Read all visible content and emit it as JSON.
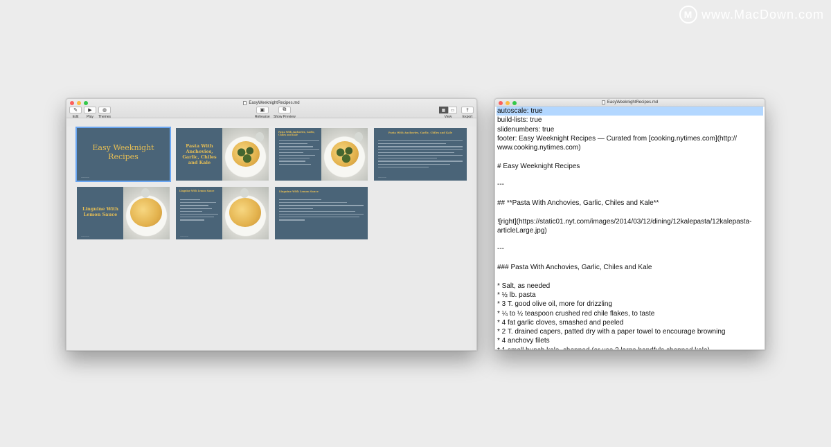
{
  "watermark": {
    "text": "www.MacDown.com",
    "logo": "M"
  },
  "deckset": {
    "title": "EasyWeeknightRecipes.md",
    "toolbar": {
      "edit": "Edit",
      "play": "Play",
      "themes": "Themes",
      "rehearse": "Rehearse",
      "show_preview": "Show Preview",
      "view": "View",
      "export": "Export"
    },
    "slides": [
      {
        "title": "Easy Weeknight Recipes"
      },
      {
        "title": "Pasta With Anchovies, Garlic, Chiles and Kale"
      },
      {
        "title": "Pasta With Anchovies, Garlic, Chiles and Kale"
      },
      {
        "title": "Pasta With Anchovies, Garlic, Chiles and Kale"
      },
      {
        "title": "Linguine With Lemon Sauce"
      },
      {
        "title": "Linguine With Lemon Sauce"
      },
      {
        "title": "Linguine With Lemon Sauce"
      }
    ]
  },
  "editor": {
    "title": "EasyWeeknightRecipes.md",
    "lines": [
      "autoscale: true",
      "build-lists: true",
      "slidenumbers: true",
      "footer: Easy Weeknight Recipes — Curated from [cooking.nytimes.com](http://",
      "www.cooking.nytimes.com)",
      "",
      "# Easy Weeknight Recipes",
      "",
      "---",
      "",
      "## **Pasta With Anchovies, Garlic, Chiles and Kale**",
      "",
      "![right](https://static01.nyt.com/images/2014/03/12/dining/12kalepasta/12kalepasta-",
      "articleLarge.jpg)",
      "",
      "---",
      "",
      "### Pasta With Anchovies, Garlic, Chiles and Kale",
      "",
      "* Salt, as needed",
      "* ½ lb. pasta",
      "* 3 T. good olive oil, more for drizzling",
      "* ¼ to ½ teaspoon crushed red chile flakes, to taste",
      "* 4 fat garlic cloves, smashed and peeled",
      "* 2 T. drained capers, patted dry with a paper towel to encourage browning",
      "* 4 anchovy filets",
      "* 1 small bunch kale, chopped (or use 3 large handfuls chopped kale)"
    ]
  },
  "colors": {
    "slide_bg": "#4a6478",
    "slide_title": "#e8bf54",
    "selection": "#b3d7ff"
  }
}
